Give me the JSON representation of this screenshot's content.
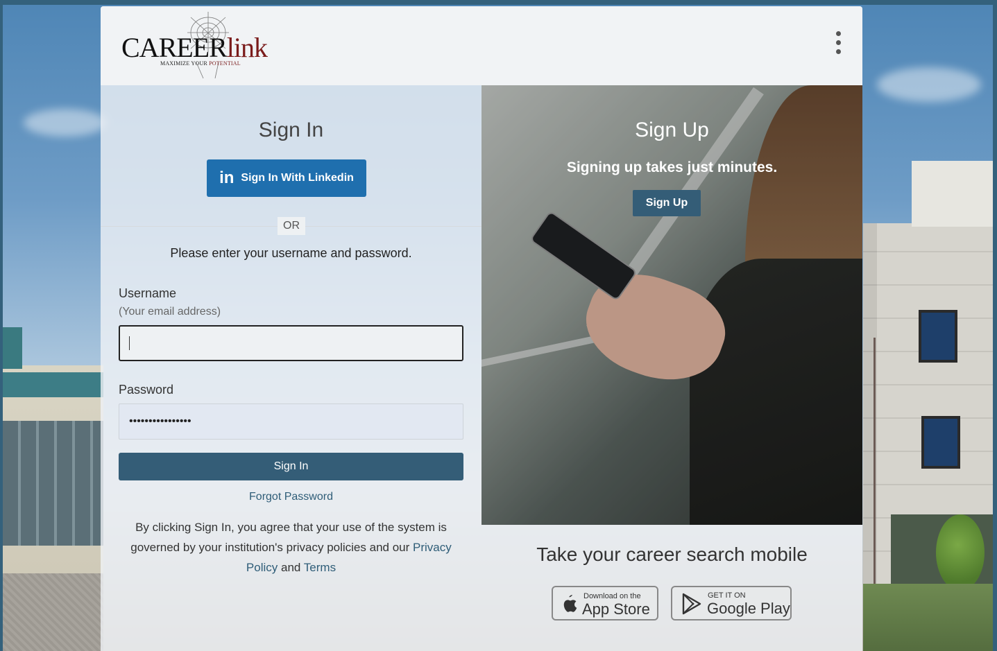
{
  "header": {
    "logo": {
      "brand_main": "CAREER",
      "brand_link": "link",
      "tagline_a": "MAXIMIZE YOUR ",
      "tagline_b": "POTENTIAL"
    },
    "menu_icon": "kebab-vertical-icon"
  },
  "signin": {
    "title": "Sign In",
    "linkedin_button": "Sign In With Linkedin",
    "linkedin_icon": "in",
    "or": "OR",
    "instructions": "Please enter your username and password.",
    "username_label": "Username",
    "username_hint": "(Your email address)",
    "username_value": "",
    "password_label": "Password",
    "password_value": "••••••••••••••••",
    "submit": "Sign In",
    "forgot": "Forgot Password",
    "legal_prefix": "By clicking Sign In, you agree that your use of the system is governed by your institution's privacy policies and our ",
    "privacy_link": "Privacy Policy",
    "legal_and": " and ",
    "terms_link": "Terms"
  },
  "signup": {
    "title": "Sign Up",
    "subtitle": "Signing up takes just minutes.",
    "button": "Sign Up"
  },
  "mobile": {
    "heading": "Take your career search mobile",
    "app_store": {
      "small": "Download on the",
      "big": "App Store",
      "icon": "apple-icon"
    },
    "google_play": {
      "small": "GET IT ON",
      "big": "Google Play",
      "icon": "google-play-icon"
    }
  },
  "colors": {
    "primary": "#345d77",
    "linkedin": "#1f6fae",
    "link": "#2f5d78",
    "frame": "#34617c"
  }
}
